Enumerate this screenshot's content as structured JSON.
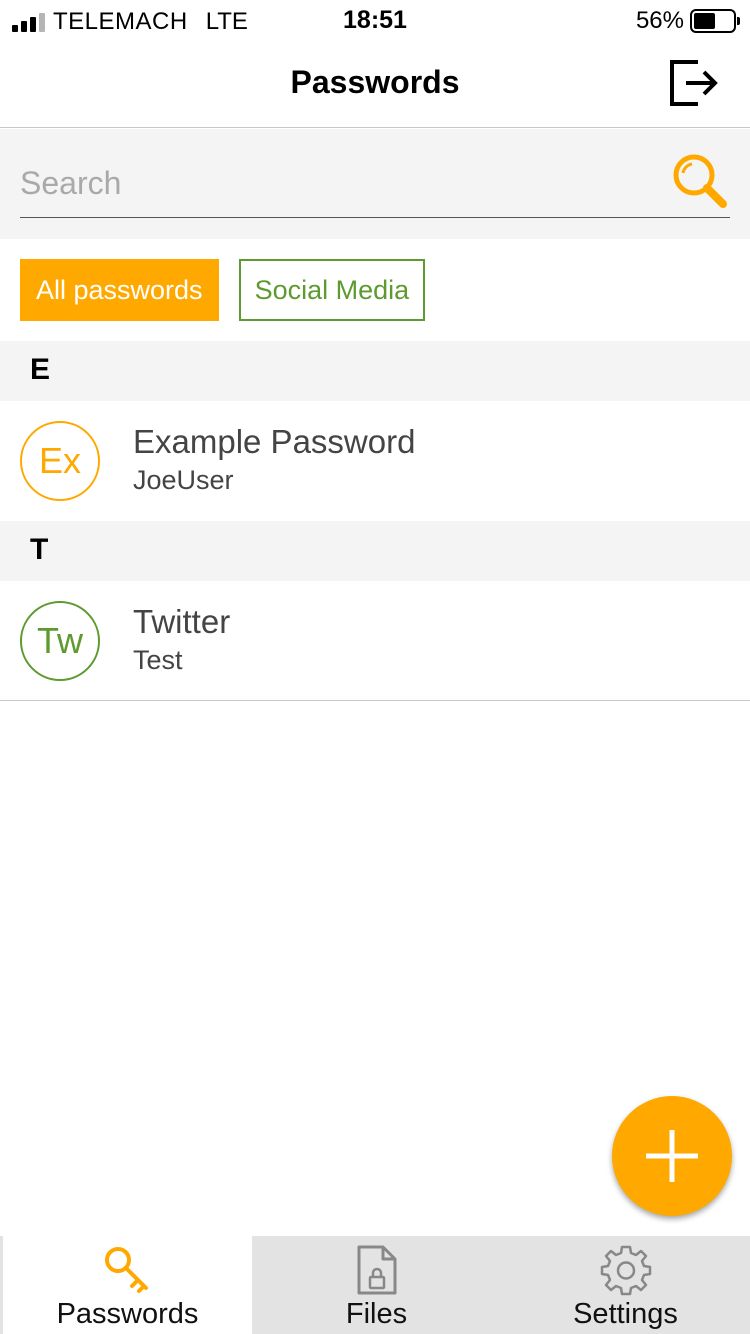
{
  "status_bar": {
    "carrier": "TELEMACH",
    "network": "LTE",
    "time": "18:51",
    "battery_percent": "56%",
    "battery_level": 0.56
  },
  "header": {
    "title": "Passwords",
    "logout_icon": "logout-icon"
  },
  "search": {
    "placeholder": "Search",
    "value": "",
    "icon": "search-icon"
  },
  "filters": [
    {
      "label": "All passwords",
      "active": true
    },
    {
      "label": "Social Media",
      "active": false
    }
  ],
  "sections": [
    {
      "letter": "E",
      "items": [
        {
          "initials": "Ex",
          "title": "Example Password",
          "username": "JoeUser",
          "color": "#ffa800"
        }
      ]
    },
    {
      "letter": "T",
      "items": [
        {
          "initials": "Tw",
          "title": "Twitter",
          "username": "Test",
          "color": "#5e9a2f"
        }
      ]
    }
  ],
  "fab": {
    "icon": "plus-icon"
  },
  "tabs": [
    {
      "label": "Passwords",
      "icon": "key-icon",
      "active": true
    },
    {
      "label": "Files",
      "icon": "file-lock-icon",
      "active": false
    },
    {
      "label": "Settings",
      "icon": "gear-icon",
      "active": false
    }
  ],
  "colors": {
    "accent": "#ffa800",
    "secondary": "#5e9a2f",
    "section_bg": "#f4f4f4",
    "tab_bg": "#e3e3e3"
  }
}
